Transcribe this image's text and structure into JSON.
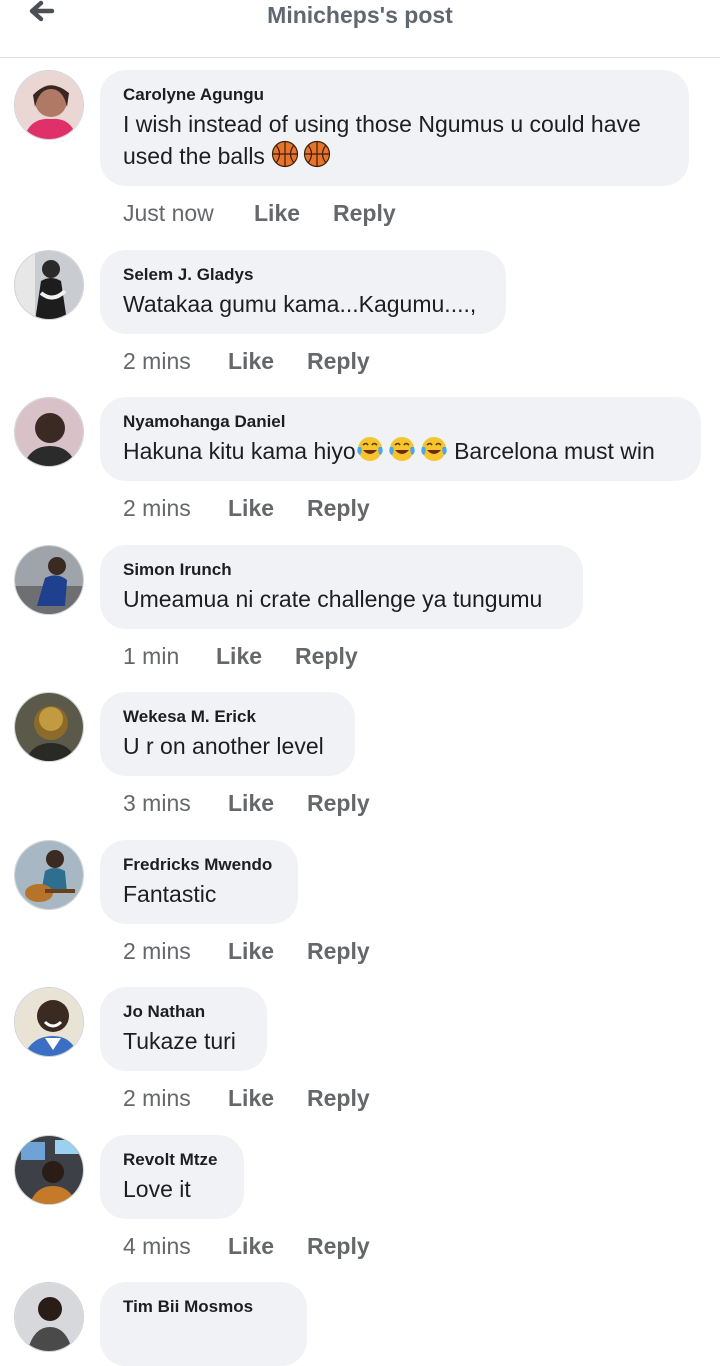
{
  "header": {
    "back_icon": "arrow-left-icon",
    "title": "Minicheps's post"
  },
  "comments": [
    {
      "author": "Carolyne Agungu",
      "text": "I wish instead of using those Ngumus u could have used the balls",
      "emoji": "basketball basketball",
      "time": "Just now",
      "like": "Like",
      "reply": "Reply"
    },
    {
      "author": "Selem J. Gladys",
      "text": "Watakaa gumu kama...Kagumu....,",
      "time": "2 mins",
      "like": "Like",
      "reply": "Reply"
    },
    {
      "author": "Nyamohanga Daniel",
      "text_before": "Hakuna kitu kama hiyo",
      "emoji": "tears-of-joy x3",
      "text_after": " Barcelona must win",
      "time": "2 mins",
      "like": "Like",
      "reply": "Reply"
    },
    {
      "author": "Simon Irunch",
      "text": "Umeamua ni crate challenge ya tungumu",
      "time": "1 min",
      "like": "Like",
      "reply": "Reply"
    },
    {
      "author": "Wekesa M. Erick",
      "text": "U r on another level",
      "time": "3 mins",
      "like": "Like",
      "reply": "Reply"
    },
    {
      "author": "Fredricks Mwendo",
      "text": "Fantastic",
      "time": "2 mins",
      "like": "Like",
      "reply": "Reply"
    },
    {
      "author": "Jo Nathan",
      "text": "Tukaze turi",
      "time": "2 mins",
      "like": "Like",
      "reply": "Reply"
    },
    {
      "author": "Revolt Mtze",
      "text": "Love it",
      "time": "4 mins",
      "like": "Like",
      "reply": "Reply"
    },
    {
      "author": "Tim Bii Mosmos"
    }
  ],
  "colors": {
    "bubble": "#f0f2f5",
    "muted_text": "#65676b",
    "primary_text": "#1c1e21",
    "divider": "#dadde1"
  }
}
